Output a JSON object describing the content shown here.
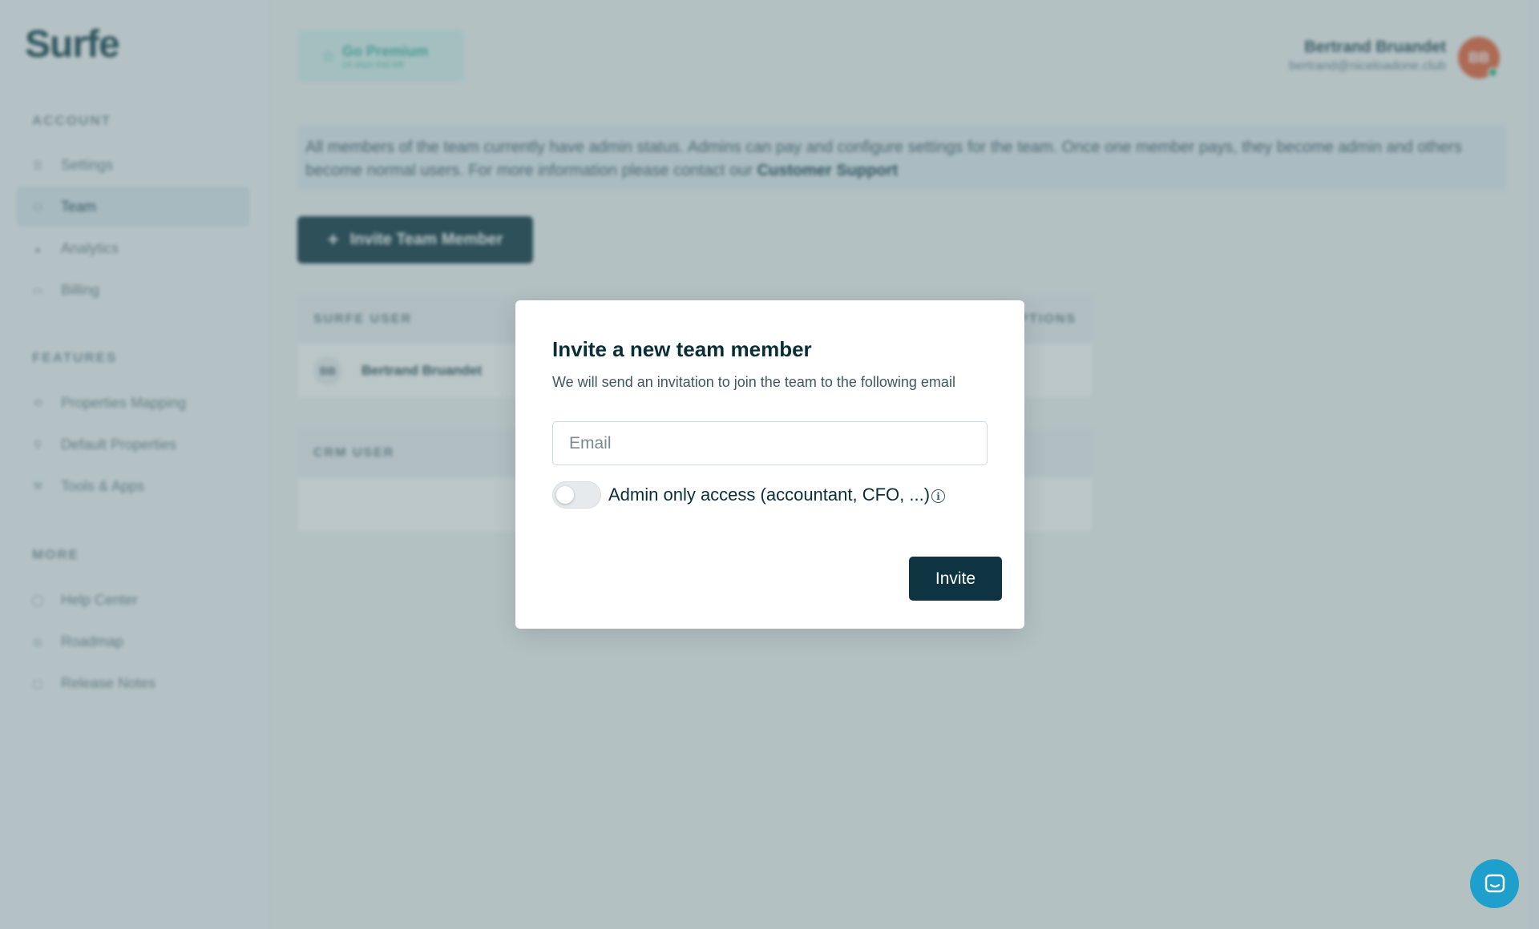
{
  "app": {
    "logo": "Surfe"
  },
  "sidebar": {
    "sections": [
      {
        "title": "ACCOUNT",
        "items": [
          {
            "label": "Settings",
            "icon": "settings-icon"
          },
          {
            "label": "Team",
            "icon": "team-icon",
            "active": true
          },
          {
            "label": "Analytics",
            "icon": "analytics-icon"
          },
          {
            "label": "Billing",
            "icon": "billing-icon"
          }
        ]
      },
      {
        "title": "FEATURES",
        "items": [
          {
            "label": "Properties Mapping",
            "icon": "mapping-icon"
          },
          {
            "label": "Default Properties",
            "icon": "default-properties-icon"
          },
          {
            "label": "Tools & Apps",
            "icon": "tools-icon"
          }
        ]
      },
      {
        "title": "MORE",
        "items": [
          {
            "label": "Help Center",
            "icon": "help-icon"
          },
          {
            "label": "Roadmap",
            "icon": "roadmap-icon"
          },
          {
            "label": "Release Notes",
            "icon": "release-notes-icon"
          }
        ]
      }
    ]
  },
  "header": {
    "premium": {
      "title": "Go Premium",
      "subtitle": "14 days trial left"
    },
    "user": {
      "name": "Bertrand Bruandet",
      "email": "bertrand@niceloadone.club",
      "avatar_initials": "BB"
    }
  },
  "banner": {
    "text": "All members of the team currently have admin status. Admins can pay and configure settings for the team. Once one member pays, they become admin and others become normal users. For more information please contact our",
    "link": "Customer Support"
  },
  "main": {
    "invite_team_member_label": "Invite Team Member",
    "surfe_table": {
      "header_left": "SURFE USER",
      "header_right": "OPTIONS",
      "rows": [
        {
          "initials": "BB",
          "name": "Bertrand Bruandet"
        }
      ]
    },
    "crm_table": {
      "header_left": "CRM USER"
    }
  },
  "modal": {
    "title": "Invite a new team member",
    "description": "We will send an invitation to join the team to the following email",
    "email_placeholder": "Email",
    "email_value": "",
    "toggle_label": "Admin only access (accountant, CFO, ...)",
    "toggle_on": false,
    "invite_label": "Invite"
  },
  "colors": {
    "primary": "#0d3440",
    "overlay": "#5a767c",
    "chat": "#1f9fcb",
    "avatar": "#e8623a",
    "premium_bg": "#d9f3f1"
  }
}
